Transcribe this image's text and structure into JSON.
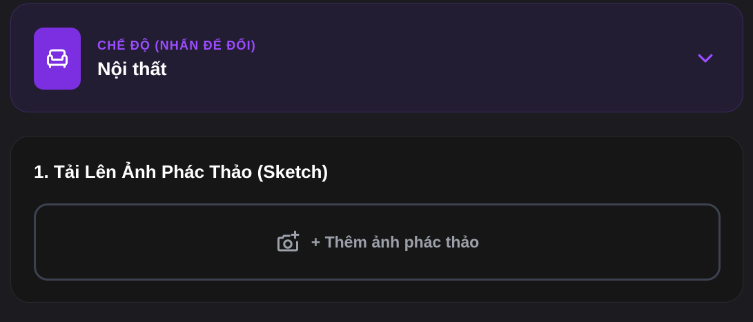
{
  "mode": {
    "caption": "CHẾ ĐỘ (NHẤN ĐỂ ĐỔI)",
    "value": "Nội thất",
    "icon": "armchair-icon",
    "chevron_icon": "chevron-down-icon"
  },
  "upload": {
    "title": "1. Tải Lên Ảnh Phác Thảo (Sketch)",
    "button_label": "+ Thêm ảnh phác thảo",
    "icon": "camera-plus-icon"
  },
  "colors": {
    "accent": "#7c2fe0",
    "accent_text": "#9b4dff",
    "background": "#1c1b1f",
    "mode_card_bg": "#231d33",
    "upload_card_bg": "#161616",
    "upload_border": "#3d4250",
    "muted_text": "#9ca0aa"
  }
}
